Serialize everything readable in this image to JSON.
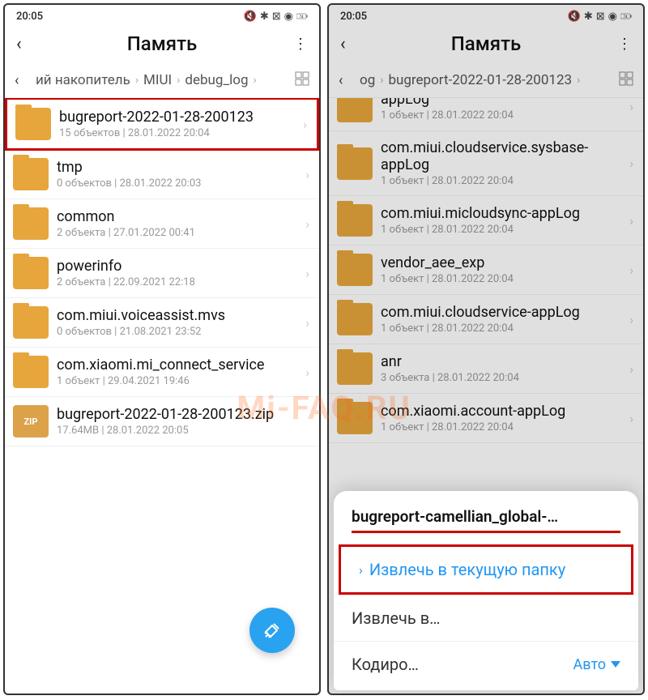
{
  "watermark": "Mi-FAQ.RU",
  "left": {
    "status": {
      "time": "20:05",
      "battery": "74"
    },
    "title": "Память",
    "breadcrumb": {
      "parts": [
        "ий накопитель",
        "MIUI",
        "debug_log"
      ]
    },
    "rows": [
      {
        "type": "folder",
        "name": "bugreport-2022-01-28-200123",
        "meta": "15 объектов | 28.01.2022 20:04",
        "highlight": true
      },
      {
        "type": "folder",
        "name": "tmp",
        "meta": "0 объектов | 28.01.2022 20:03"
      },
      {
        "type": "folder",
        "name": "common",
        "meta": "2 объекта | 27.01.2022 00:41"
      },
      {
        "type": "folder",
        "name": "powerinfo",
        "meta": "2 объекта | 22.09.2021 22:18"
      },
      {
        "type": "folder",
        "name": "com.miui.voiceassist.mvs",
        "meta": "0 объектов | 21.08.2021 23:52"
      },
      {
        "type": "folder",
        "name": "com.xiaomi.mi_connect_service",
        "meta": "1 объект | 29.04.2021 19:46"
      },
      {
        "type": "zip",
        "name": "bugreport-2022-01-28-200123.zip",
        "meta": "17.64MB | 28.01.2022 20:05",
        "zip_label": "ZIP"
      }
    ]
  },
  "right": {
    "status": {
      "time": "20:05",
      "battery": "74"
    },
    "title": "Память",
    "breadcrumb": {
      "parts": [
        "og",
        "bugreport-2022-01-28-200123"
      ]
    },
    "rows": [
      {
        "type": "folder",
        "name": "appLog",
        "meta": "1 объект | 28.01.2022 20:04",
        "partial": true
      },
      {
        "type": "folder",
        "name": "com.miui.cloudservice.sysbase-appLog",
        "meta": "1 объект | 28.01.2022 20:04"
      },
      {
        "type": "folder",
        "name": "com.miui.micloudsync-appLog",
        "meta": "1 объект | 28.01.2022 20:04"
      },
      {
        "type": "folder",
        "name": "vendor_aee_exp",
        "meta": "1 объект | 28.01.2022 20:04"
      },
      {
        "type": "folder",
        "name": "com.miui.cloudservice-appLog",
        "meta": "1 объект | 28.01.2022 20:04"
      },
      {
        "type": "folder",
        "name": "anr",
        "meta": "3 объекта | 28.01.2022 20:04"
      },
      {
        "type": "folder",
        "name": "com.xiaomi.account-appLog",
        "meta": "1 объект | 28.01.2022 20:04"
      }
    ],
    "sheet": {
      "title": "bugreport-camellian_global-…",
      "opt_extract_here": "Извлечь в текущую папку",
      "opt_extract_to": "Извлечь в…",
      "encoding_label": "Кодиро…",
      "encoding_value": "Авто"
    }
  }
}
